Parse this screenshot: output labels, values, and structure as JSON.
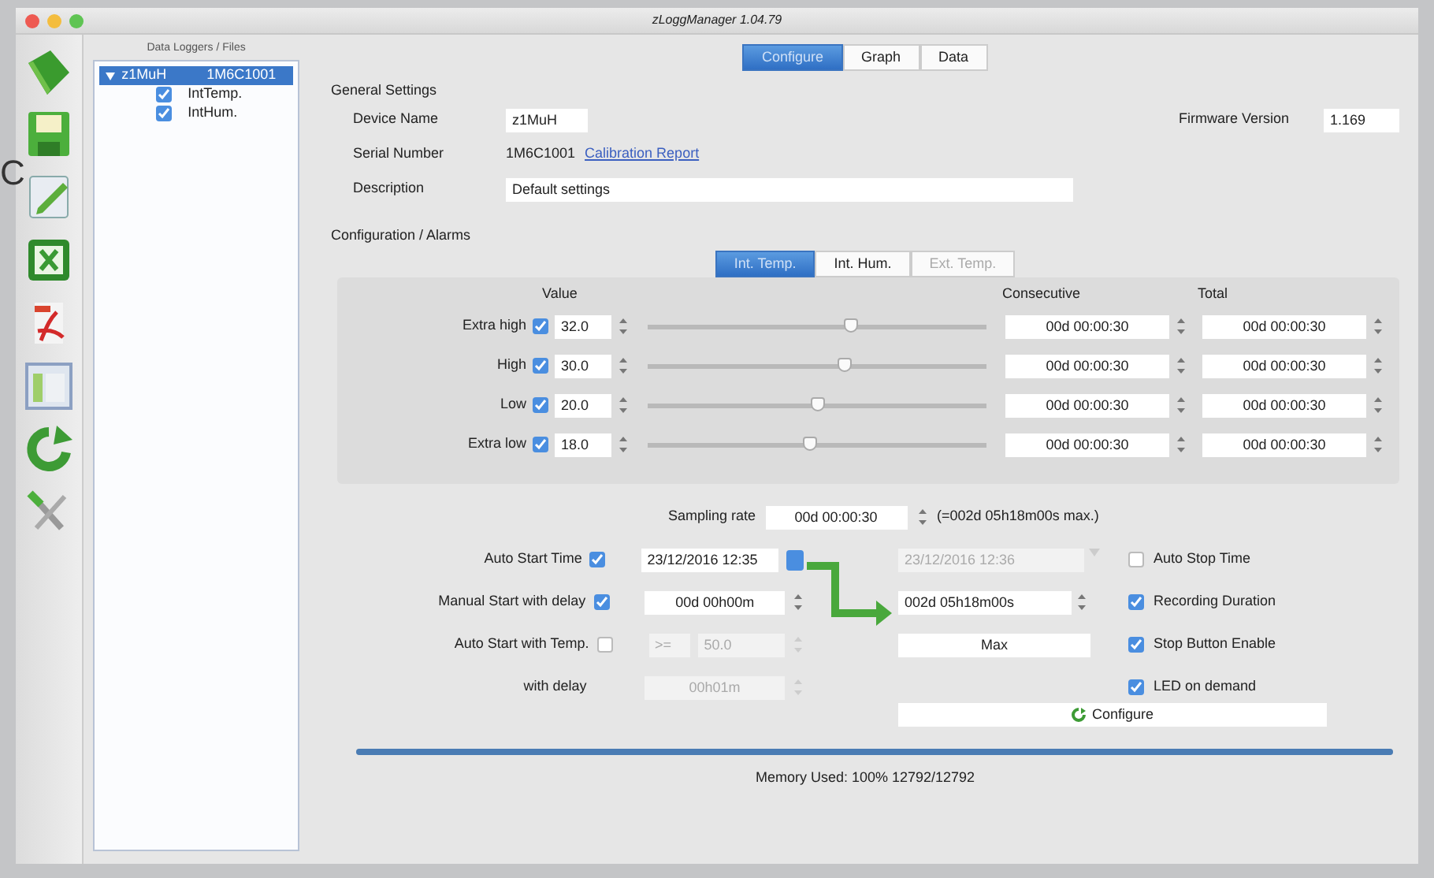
{
  "background_text": "C",
  "window": {
    "title": "zLoggManager 1.04.79"
  },
  "tree": {
    "header": "Data Loggers / Files",
    "items": [
      {
        "label": "z1MuH",
        "serial": "1M6C1001",
        "selected": true,
        "expanded": true,
        "children": [
          {
            "label": "IntTemp.",
            "checked": true
          },
          {
            "label": "IntHum.",
            "checked": true
          }
        ]
      }
    ]
  },
  "tabs": [
    {
      "label": "Configure",
      "selected": true
    },
    {
      "label": "Graph",
      "selected": false
    },
    {
      "label": "Data",
      "selected": false
    }
  ],
  "general": {
    "title": "General Settings",
    "device_name": {
      "label": "Device Name",
      "value": "z1MuH"
    },
    "serial": {
      "label": "Serial Number",
      "value": "1M6C1001",
      "link": "Calibration Report"
    },
    "description": {
      "label": "Description",
      "value": "Default settings"
    },
    "firmware": {
      "label": "Firmware Version",
      "value": "1.169"
    }
  },
  "alarms": {
    "title": "Configuration / Alarms",
    "subtabs": [
      {
        "label": "Int. Temp.",
        "selected": true,
        "disabled": false
      },
      {
        "label": "Int. Hum.",
        "selected": false,
        "disabled": false
      },
      {
        "label": "Ext. Temp.",
        "selected": false,
        "disabled": true
      }
    ],
    "columns": [
      "Value",
      "Consecutive",
      "Total"
    ],
    "rows": [
      {
        "label": "Extra high",
        "checked": true,
        "value": "32.0",
        "level": 0.6,
        "consecutive": "00d 00:00:30",
        "total": "00d 00:00:30"
      },
      {
        "label": "High",
        "checked": true,
        "value": "30.0",
        "level": 0.58,
        "consecutive": "00d 00:00:30",
        "total": "00d 00:00:30"
      },
      {
        "label": "Low",
        "checked": true,
        "value": "20.0",
        "level": 0.5,
        "consecutive": "00d 00:00:30",
        "total": "00d 00:00:30"
      },
      {
        "label": "Extra low",
        "checked": true,
        "value": "18.0",
        "level": 0.48,
        "consecutive": "00d 00:00:30",
        "total": "00d 00:00:30"
      }
    ]
  },
  "sampling": {
    "label": "Sampling rate",
    "value": "00d 00:00:30",
    "note": "(=002d 05h18m00s max.)"
  },
  "start": {
    "auto_start_time": {
      "label": "Auto Start Time",
      "checked": true,
      "value": "23/12/2016 12:35"
    },
    "manual_start": {
      "label": "Manual Start with delay",
      "checked": true,
      "value": "00d 00h00m"
    },
    "auto_start_temp": {
      "label": "Auto Start with Temp.",
      "checked": false,
      "operator": ">=",
      "value": "50.0"
    },
    "with_delay": {
      "label": "with delay",
      "value": "00h01m"
    }
  },
  "stop": {
    "auto_stop_time": {
      "label": "Auto Stop Time",
      "checked": false,
      "value": "23/12/2016 12:36"
    },
    "recording_duration": {
      "label": "Recording Duration",
      "checked": true,
      "value": "002d 05h18m00s"
    },
    "max_button": "Max",
    "stop_button": {
      "label": "Stop Button Enable",
      "checked": true
    },
    "led": {
      "label": "LED on demand",
      "checked": true
    },
    "configure_button": "Configure"
  },
  "memory": {
    "level": 1.0,
    "text": "Memory Used: 100% 12792/12792"
  }
}
